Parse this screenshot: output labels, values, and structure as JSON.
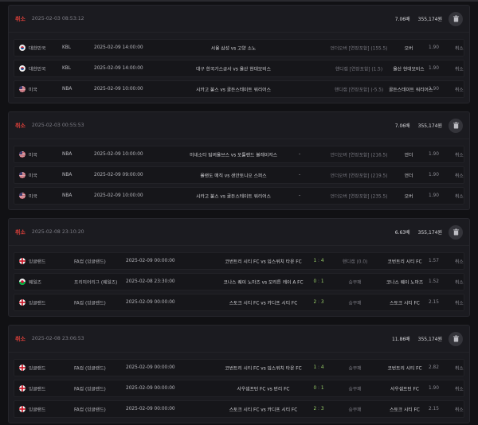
{
  "colors": {
    "cancel": "#e0403a",
    "score": "#9ad06a"
  },
  "slips": [
    {
      "status_label": "취소",
      "timestamp": "2025-02-03 08:53:12",
      "count": "7.06배",
      "amount": "355,174원",
      "rows": [
        {
          "flag": "kr",
          "country": "대한민국",
          "league": "KBL",
          "date": "2025-02-09 14:00:00",
          "match": "서울 삼성 vs 고양 소노",
          "score": "",
          "market": "언더오버 [연장포함] (155.5)",
          "pick": "오버",
          "odds": "1.90",
          "status": "취소"
        },
        {
          "flag": "kr",
          "country": "대한민국",
          "league": "KBL",
          "date": "2025-02-09 14:00:00",
          "match": "대구 한국가스공사 vs 울산 현대모비스",
          "score": "",
          "market": "핸디캡 [연장포함] (1.5)",
          "pick": "울산 현대모비스",
          "odds": "1.90",
          "status": "취소"
        },
        {
          "flag": "us",
          "country": "미국",
          "league": "NBA",
          "date": "2025-02-09 10:00:00",
          "match": "시카고 불스 vs 골든스테이트 워리어스",
          "score": "",
          "market": "핸디캡 [연장포함] (-5.5)",
          "pick": "골든스테이트 워리어스",
          "odds": "1.90",
          "status": "취소"
        }
      ]
    },
    {
      "status_label": "취소",
      "timestamp": "2025-02-03 00:55:53",
      "count": "7.06배",
      "amount": "355,174원",
      "rows": [
        {
          "flag": "us",
          "country": "미국",
          "league": "NBA",
          "date": "2025-02-09 10:00:00",
          "match": "미네소타 팀버울브스 vs 포틀랜드 블레이저스",
          "score": "-",
          "market": "언더오버 [연장포함] (216.5)",
          "pick": "언더",
          "odds": "1.90",
          "status": "취소"
        },
        {
          "flag": "us",
          "country": "미국",
          "league": "NBA",
          "date": "2025-02-09 09:00:00",
          "match": "올랜도 매직 vs 샌안토니오 스퍼스",
          "score": "-",
          "market": "언더오버 [연장포함] (219.5)",
          "pick": "언더",
          "odds": "1.90",
          "status": "취소"
        },
        {
          "flag": "us",
          "country": "미국",
          "league": "NBA",
          "date": "2025-02-09 10:00:00",
          "match": "시카고 불스 vs 골든스테이트 워리어스",
          "score": "-",
          "market": "언더오버 [연장포함] (235.5)",
          "pick": "오버",
          "odds": "1.90",
          "status": "취소"
        }
      ]
    },
    {
      "status_label": "취소",
      "timestamp": "2025-02-08 23:10:20",
      "count": "6.63배",
      "amount": "355,174원",
      "rows": [
        {
          "flag": "en",
          "country": "잉글랜드",
          "league": "FA컵 (잉글랜드)",
          "date": "2025-02-09 00:00:00",
          "match": "코번트리 시티 FC vs 임스위치 타운 FC",
          "score_h": "1",
          "score_a": "4",
          "market": "핸디캡 (0.0)",
          "pick": "코번트리 시티 FC",
          "odds": "1.57",
          "status": "취소"
        },
        {
          "flag": "wa",
          "country": "웨일즈",
          "league": "프리미어리그 (웨일즈)",
          "date": "2025-02-08 23:30:00",
          "match": "코나스 퀘이 노마즈 vs 모리튼 레이 A FC",
          "score_h": "0",
          "score_a": "1",
          "market": "승무패",
          "pick": "코나스 퀘이 노마즈",
          "odds": "1.52",
          "status": "취소"
        },
        {
          "flag": "en",
          "country": "잉글랜드",
          "league": "FA컵 (잉글랜드)",
          "date": "2025-02-09 00:00:00",
          "match": "스토크 시티 FC vs 카디프 시티 FC",
          "score_h": "2",
          "score_a": "3",
          "market": "승무패",
          "pick": "스토크 시티 FC",
          "odds": "2.15",
          "status": "취소"
        }
      ]
    },
    {
      "status_label": "취소",
      "timestamp": "2025-02-08 23:06:53",
      "count": "11.86배",
      "amount": "355,174원",
      "rows": [
        {
          "flag": "en",
          "country": "잉글랜드",
          "league": "FA컵 (잉글랜드)",
          "date": "2025-02-09 00:00:00",
          "match": "코번트리 시티 FC vs 임스위치 타운 FC",
          "score_h": "1",
          "score_a": "4",
          "market": "승무패",
          "pick": "코번트리 시티 FC",
          "odds": "2.82",
          "status": "취소"
        },
        {
          "flag": "en",
          "country": "잉글랜드",
          "league": "FA컵 (잉글랜드)",
          "date": "2025-02-09 00:00:00",
          "match": "사우샘프턴 FC vs 번리 FC",
          "score_h": "0",
          "score_a": "1",
          "market": "승무패",
          "pick": "사우샘프턴 FC",
          "odds": "1.90",
          "status": "취소"
        },
        {
          "flag": "en",
          "country": "잉글랜드",
          "league": "FA컵 (잉글랜드)",
          "date": "2025-02-09 00:00:00",
          "match": "스토크 시티 FC vs 카디프 시티 FC",
          "score_h": "2",
          "score_a": "3",
          "market": "승무패",
          "pick": "스토크 시티 FC",
          "odds": "2.15",
          "status": "취소"
        }
      ]
    }
  ]
}
